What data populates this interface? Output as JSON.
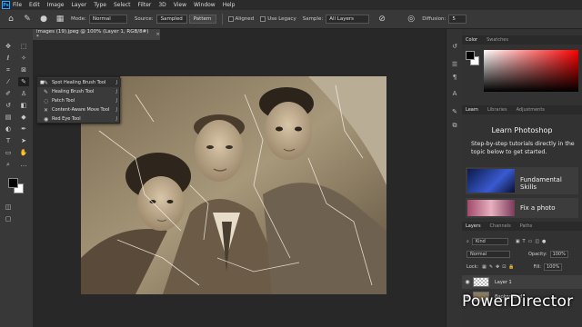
{
  "menubar": {
    "logo": "Ps",
    "items": [
      "File",
      "Edit",
      "Image",
      "Layer",
      "Type",
      "Select",
      "Filter",
      "3D",
      "View",
      "Window",
      "Help"
    ]
  },
  "options": {
    "mode_label": "Mode:",
    "mode_value": "Normal",
    "source_label": "Source:",
    "sampled_label": "Sampled",
    "pattern_label": "Pattern",
    "aligned_label": "Aligned",
    "legacy_label": "Use Legacy",
    "sample_label": "Sample:",
    "sample_value": "All Layers",
    "diffusion_label": "Diffusion:",
    "diffusion_value": "5"
  },
  "document": {
    "tab_title": "images (19).jpeg @ 100% (Layer 1, RGB/8#) *",
    "close_glyph": "×"
  },
  "flyout": {
    "items": [
      {
        "label": "Spot Healing Brush Tool",
        "key": "J",
        "selected": true
      },
      {
        "label": "Healing Brush Tool",
        "key": "J",
        "selected": false
      },
      {
        "label": "Patch Tool",
        "key": "J",
        "selected": false
      },
      {
        "label": "Content-Aware Move Tool",
        "key": "J",
        "selected": false
      },
      {
        "label": "Red Eye Tool",
        "key": "J",
        "selected": false
      }
    ]
  },
  "panels": {
    "color_tabs": [
      "Color",
      "Swatches"
    ],
    "learn_tabs": [
      "Learn",
      "Libraries",
      "Adjustments"
    ],
    "learn_title": "Learn Photoshop",
    "learn_subtitle": "Step-by-step tutorials directly in the topic below to get started.",
    "learn_cards": [
      "Fundamental Skills",
      "Fix a photo"
    ],
    "layers_tabs": [
      "Layers",
      "Channels",
      "Paths"
    ],
    "kind_label": "Kind",
    "blend_mode": "Normal",
    "opacity_label": "Opacity:",
    "opacity_value": "100%",
    "lock_label": "Lock:",
    "fill_label": "Fill:",
    "fill_value": "100%",
    "layers": [
      "Layer 1",
      "Background"
    ]
  },
  "watermark": "PowerDirector",
  "colors": {
    "accent": "#31a8ff",
    "foreground": "#000000",
    "background": "#ffffff",
    "hue": "#ff0000"
  }
}
